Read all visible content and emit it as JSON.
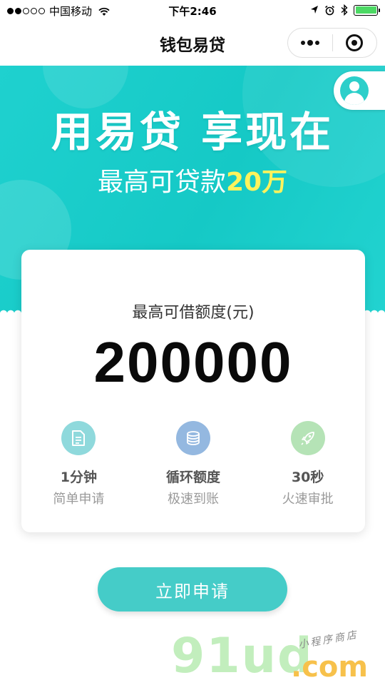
{
  "status_bar": {
    "carrier": "中国移动",
    "time": "下午2:46",
    "battery_color": "#4cd964",
    "icons": [
      "signal-icon",
      "wifi-icon",
      "location-icon",
      "alarm-icon",
      "bluetooth-icon",
      "battery-icon"
    ]
  },
  "nav": {
    "title": "钱包易贷",
    "capsule_icons": [
      "more-icon",
      "close-target-icon"
    ]
  },
  "banner": {
    "title": "用易贷 享现在",
    "subtitle_prefix": "最高可贷款",
    "subtitle_highlight": "20万",
    "background_color": "#1fd1cf",
    "highlight_color": "#fff35c"
  },
  "card": {
    "label": "最高可借额度(元)",
    "amount": "200000",
    "features": [
      {
        "icon": "document-icon",
        "title": "1分钟",
        "subtitle": "简单申请",
        "icon_color": "#8fd9dc"
      },
      {
        "icon": "coins-icon",
        "title": "循环额度",
        "subtitle": "极速到账",
        "icon_color": "#94b8e0"
      },
      {
        "icon": "rocket-icon",
        "title": "30秒",
        "subtitle": "火速审批",
        "icon_color": "#b5e3b6"
      }
    ]
  },
  "apply_button": {
    "label": "立即申请",
    "color": "#45ccc8"
  },
  "watermark": {
    "logo": "91ud",
    "domain": ".com",
    "tagline": "小程序商店"
  }
}
